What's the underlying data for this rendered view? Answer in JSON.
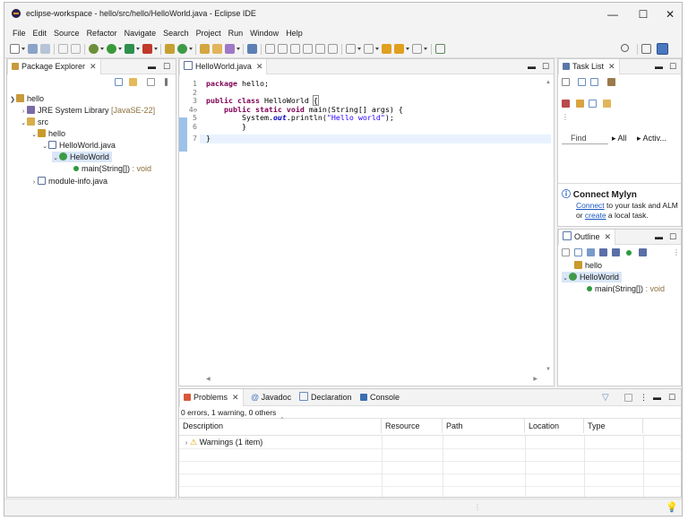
{
  "window": {
    "title": "eclipse-workspace - hello/src/hello/HelloWorld.java - Eclipse IDE",
    "minimize": "—",
    "maximize": "☐",
    "close": "✕"
  },
  "menu": [
    "File",
    "Edit",
    "Source",
    "Refactor",
    "Navigate",
    "Search",
    "Project",
    "Run",
    "Window",
    "Help"
  ],
  "package_explorer": {
    "tab": "Package Explorer",
    "tree": {
      "project": "hello",
      "jre": "JRE System Library",
      "jre_version": "[JavaSE-22]",
      "src": "src",
      "package": "hello",
      "file": "HelloWorld.java",
      "class": "HelloWorld",
      "method": "main(String[])",
      "method_type": ": void",
      "module": "module-info.java"
    }
  },
  "editor": {
    "tab": "HelloWorld.java",
    "line_numbers": [
      "1",
      "2",
      "3",
      "4",
      "5",
      "6",
      "7"
    ],
    "fold_marker": "⊖",
    "lines": {
      "l1_kw": "package",
      "l1_rest": " hello;",
      "l3_kw": "public class",
      "l3_rest": " HelloWorld ",
      "l3_brace": "{",
      "l4_kw": "public static void",
      "l4_rest": " main(String[] args) {",
      "l5_a": "System.",
      "l5_field": "out",
      "l5_b": ".println(",
      "l5_str": "\"Hello world\"",
      "l5_c": ");",
      "l6": "}",
      "l7": "}"
    }
  },
  "task_list": {
    "tab": "Task List",
    "find_placeholder": "Find",
    "all": "All",
    "activate": "Activ..."
  },
  "mylyn": {
    "title": "Connect Mylyn",
    "connect_link": "Connect",
    "text1": " to your task and ALM",
    "or": "or ",
    "create_link": "create",
    "text2": " a local task."
  },
  "outline": {
    "tab": "Outline",
    "package": "hello",
    "class": "HelloWorld",
    "method": "main(String[])",
    "method_type": ": void"
  },
  "bottom": {
    "tabs": [
      "Problems",
      "Javadoc",
      "Declaration",
      "Console"
    ],
    "summary": "0 errors, 1 warning, 0 others",
    "columns": [
      "Description",
      "Resource",
      "Path",
      "Location",
      "Type"
    ],
    "warnings_row": "Warnings (1 item)"
  },
  "colors": {
    "keyword": "#7f0055",
    "string": "#2a00ff",
    "field": "#0000c0",
    "link": "#1a57c1",
    "selection": "#d9e6f7"
  }
}
